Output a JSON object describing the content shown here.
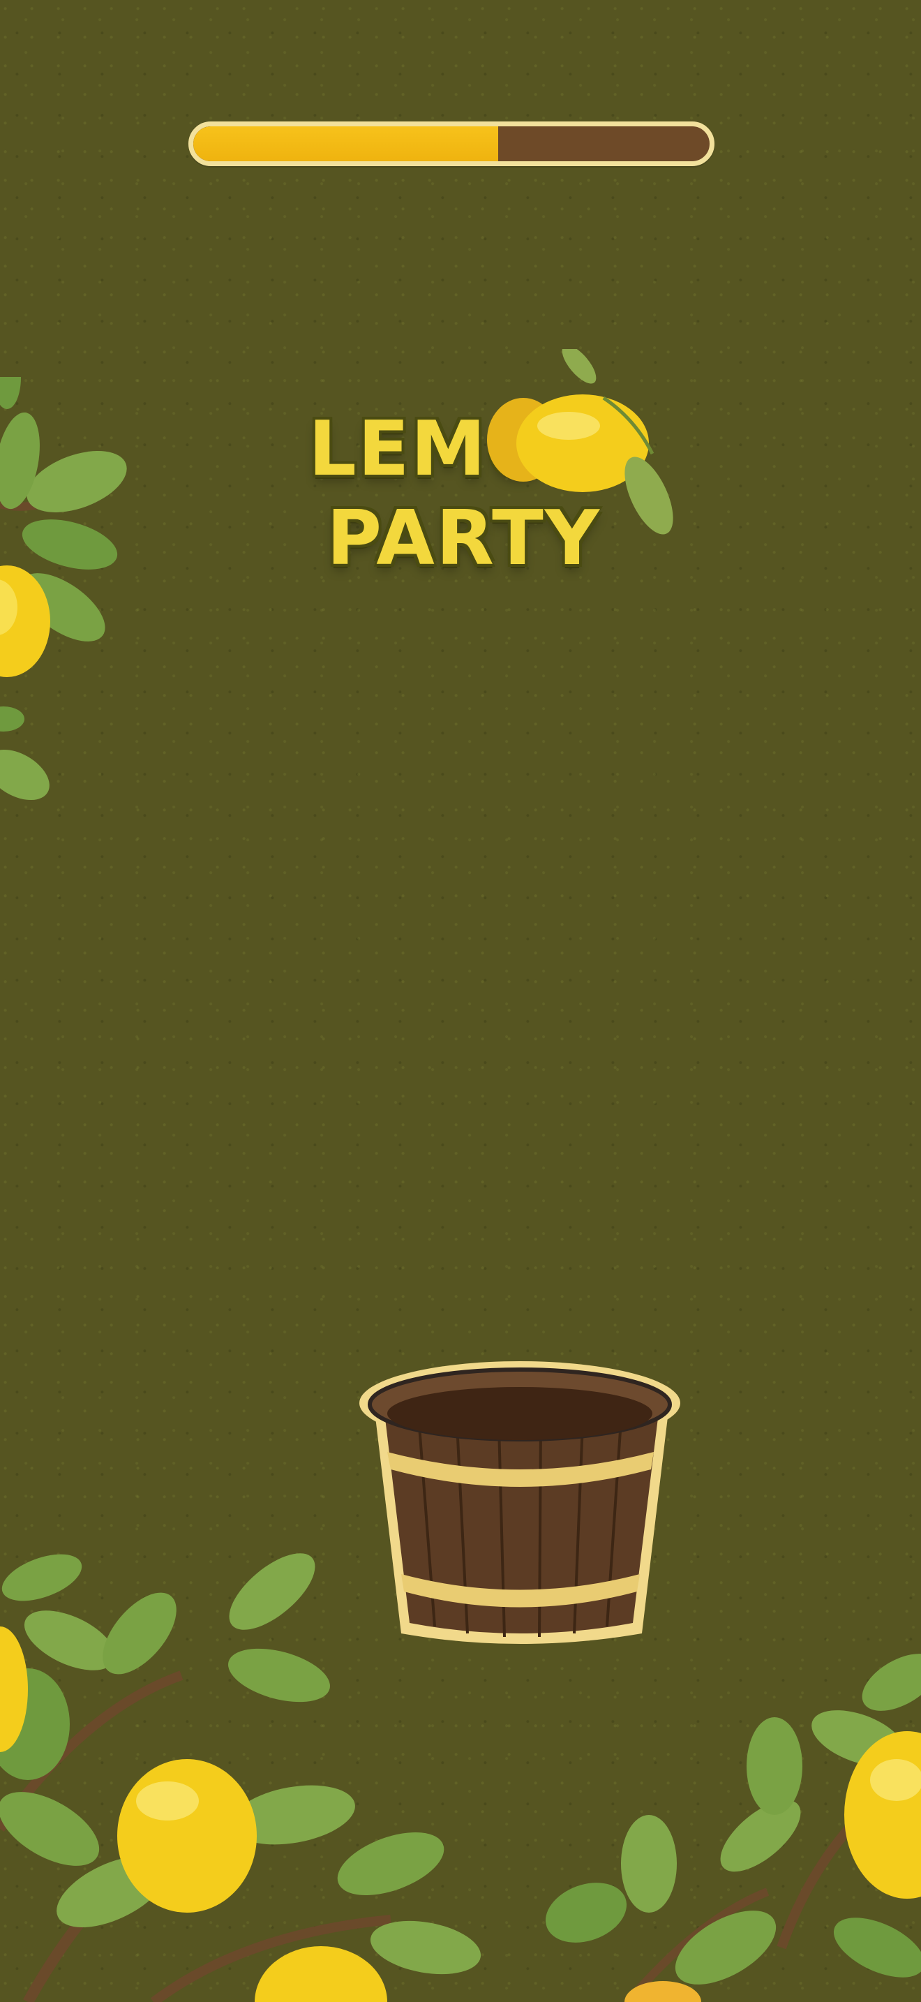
{
  "game": {
    "title_line1": "LEMON",
    "title_line2": "PARTY",
    "progress_fraction": 0.59
  },
  "colors": {
    "background": "#565521",
    "progress_fill": "#f7c21b",
    "progress_track": "#6e4a28",
    "progress_border": "#f2e19c",
    "logo_text": "#f3d83d",
    "bucket_wood": "#5a3a22",
    "bucket_band": "#e9cc72",
    "lemon": "#f6d21c",
    "leaf": "#7aa244"
  },
  "icons": [
    "lemon-icon",
    "bucket-icon",
    "leaf-icon"
  ]
}
